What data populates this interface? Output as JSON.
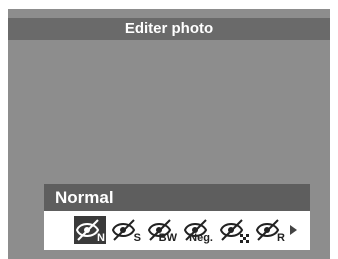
{
  "header": {
    "title": "Editer photo"
  },
  "panel": {
    "selected_label": "Normal"
  },
  "effects": [
    {
      "label": "N",
      "icon": "effect-normal-icon",
      "selected": true
    },
    {
      "label": "S",
      "icon": "effect-sepia-icon"
    },
    {
      "label": "BW",
      "icon": "effect-black-white-icon"
    },
    {
      "label": "Neg.",
      "icon": "effect-negative-icon"
    },
    {
      "label": "",
      "icon": "effect-mosaic-icon"
    },
    {
      "label": "R",
      "icon": "effect-red-icon"
    }
  ],
  "colors": {
    "screen_bg": "#8d8d8d",
    "title_bar_bg": "#6a6a6a",
    "panel_header_bg": "#5e5e5e",
    "selected_bg": "#3a3a3a"
  }
}
